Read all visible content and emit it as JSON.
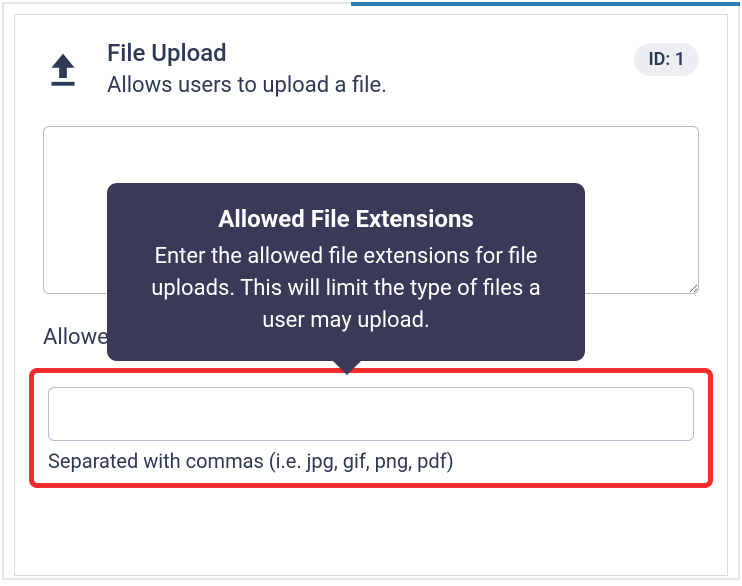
{
  "header": {
    "title": "File Upload",
    "description": "Allows users to upload a file.",
    "id_badge": "ID: 1"
  },
  "textarea": {
    "value": ""
  },
  "extensions": {
    "label": "Allowed file extensions",
    "input_value": "",
    "helper": "Separated with commas (i.e. jpg, gif, png, pdf)"
  },
  "tooltip": {
    "title": "Allowed File Extensions",
    "body": "Enter the allowed file extensions for file uploads. This will limit the type of files a user may upload."
  },
  "help_icon": {
    "glyph": "?"
  }
}
